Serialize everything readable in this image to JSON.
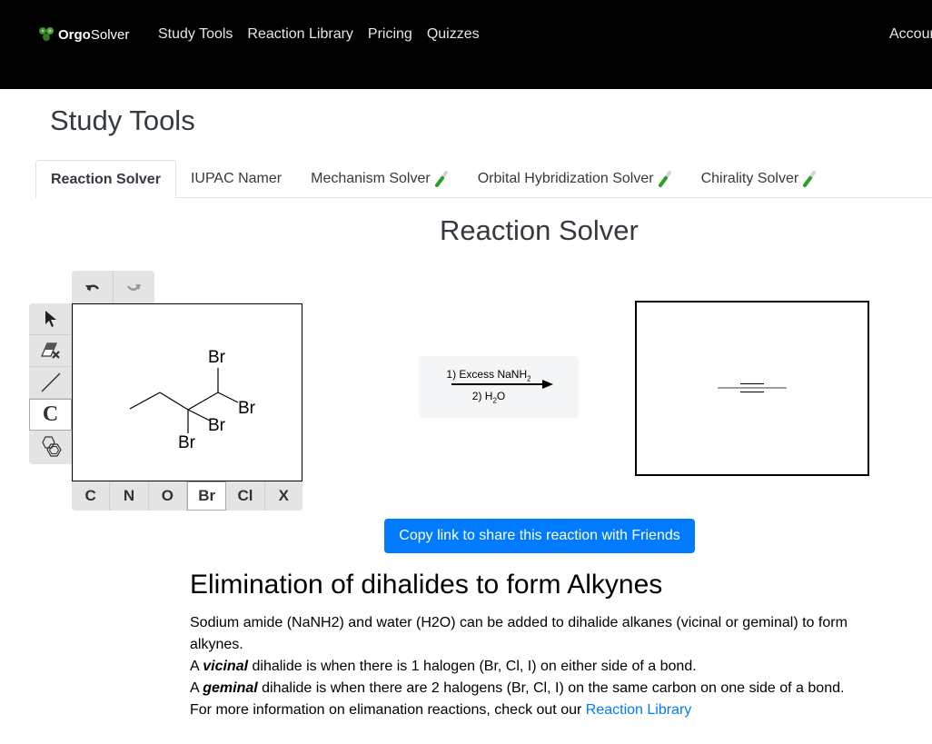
{
  "navbar": {
    "brand_bold": "Orgo",
    "brand_rest": "Solver",
    "links": [
      "Study Tools",
      "Reaction Library",
      "Pricing",
      "Quizzes"
    ],
    "account": "Account"
  },
  "page": {
    "title": "Study Tools"
  },
  "tabs": [
    {
      "label": "Reaction Solver",
      "active": true,
      "icon": null
    },
    {
      "label": "IUPAC Namer",
      "active": false,
      "icon": null
    },
    {
      "label": "Mechanism Solver",
      "active": false,
      "icon": "test-tube-icon"
    },
    {
      "label": "Orbital Hybridization Solver",
      "active": false,
      "icon": "test-tube-icon"
    },
    {
      "label": "Chirality Solver",
      "active": false,
      "icon": "test-tube-icon"
    }
  ],
  "solver": {
    "title": "Reaction Solver",
    "tools": [
      "select-arrow-icon",
      "eraser-icon",
      "bond-line-icon",
      "carbon-chain-icon",
      "ring-template-icon"
    ],
    "carbon_tool_label": "C",
    "atoms": [
      "C",
      "N",
      "O",
      "Br",
      "Cl",
      "X"
    ],
    "selected_atom": "Br",
    "reactant_labels": [
      "Br",
      "Br",
      "Br",
      "Br"
    ],
    "conditions": {
      "step1": "1) Excess NaNH",
      "step1_sub": "2",
      "step2_pre": "2) H",
      "step2_sub": "2",
      "step2_post": "O"
    },
    "share_button": "Copy link to share this reaction with Friends"
  },
  "description": {
    "title": "Elimination of dihalides to form Alkynes",
    "line1": "Sodium amide (NaNH2) and water (H2O) can be added to dihalide alkanes (vicinal or geminal) to form alkynes.",
    "line2_pre": "A ",
    "line2_em": "vicinal",
    "line2_post": " dihalide is when there is 1 halogen (Br, Cl, I) on either side of a bond.",
    "line3_pre": "A ",
    "line3_em": "geminal",
    "line3_post": " dihalide is when there are 2 halogens (Br, Cl, I) on the same carbon on one side of a bond.",
    "line4_pre": "For more information on elimanation reactions, check out our ",
    "line4_link": "Reaction Library"
  },
  "colors": {
    "navbar_bg": "#000000",
    "primary": "#007bff",
    "logo_green": "#3a8a2a",
    "tube_green": "#2aa02a"
  }
}
